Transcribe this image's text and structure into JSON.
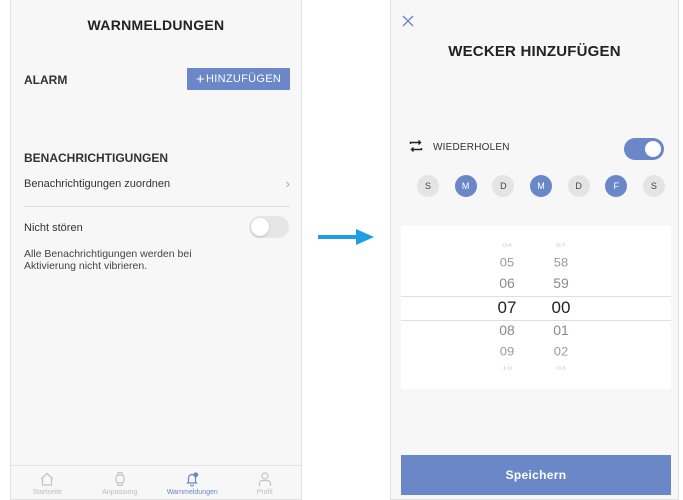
{
  "left": {
    "header": {
      "title": "WARNMELDUNGEN"
    },
    "alarm": {
      "label": "ALARM",
      "add_plus": "+",
      "add_label": "HINZUFÜGEN"
    },
    "notifications": {
      "title": "BENACHRICHTIGUNGEN",
      "assign_label": "Benachrichtigungen zuordnen",
      "assign_chevron": "›",
      "dnd_label": "Nicht stören",
      "dnd_enabled": false,
      "dnd_description": "Alle Benachrichtigungen werden bei Aktivierung nicht vibrieren."
    },
    "tabbar": {
      "items": [
        {
          "label": "Startseite",
          "icon": "home-icon",
          "active": false
        },
        {
          "label": "Anpassung",
          "icon": "watch-icon",
          "active": false
        },
        {
          "label": "Warnmeldungen",
          "icon": "bell-icon",
          "active": true
        },
        {
          "label": "Profil",
          "icon": "profile-icon",
          "active": false
        }
      ]
    }
  },
  "right": {
    "close_icon": "close-icon",
    "header": {
      "title": "WECKER HINZUFÜGEN"
    },
    "repeat": {
      "label": "WIEDERHOLEN",
      "icon": "repeat-icon",
      "enabled": true
    },
    "days": [
      {
        "label": "S",
        "selected": false
      },
      {
        "label": "M",
        "selected": true
      },
      {
        "label": "D",
        "selected": false
      },
      {
        "label": "M",
        "selected": true
      },
      {
        "label": "D",
        "selected": false
      },
      {
        "label": "F",
        "selected": true
      },
      {
        "label": "S",
        "selected": false
      }
    ],
    "time_picker": {
      "hours": [
        "04",
        "05",
        "06",
        "07",
        "08",
        "09",
        "10"
      ],
      "minutes": [
        "57",
        "58",
        "59",
        "00",
        "01",
        "02",
        "03"
      ],
      "selected_hour": "07",
      "selected_minute": "00"
    },
    "save_label": "Speichern"
  },
  "colors": {
    "accent": "#6a87c8",
    "arrow": "#1e9ee6",
    "inactive": "#bdbdbd"
  }
}
